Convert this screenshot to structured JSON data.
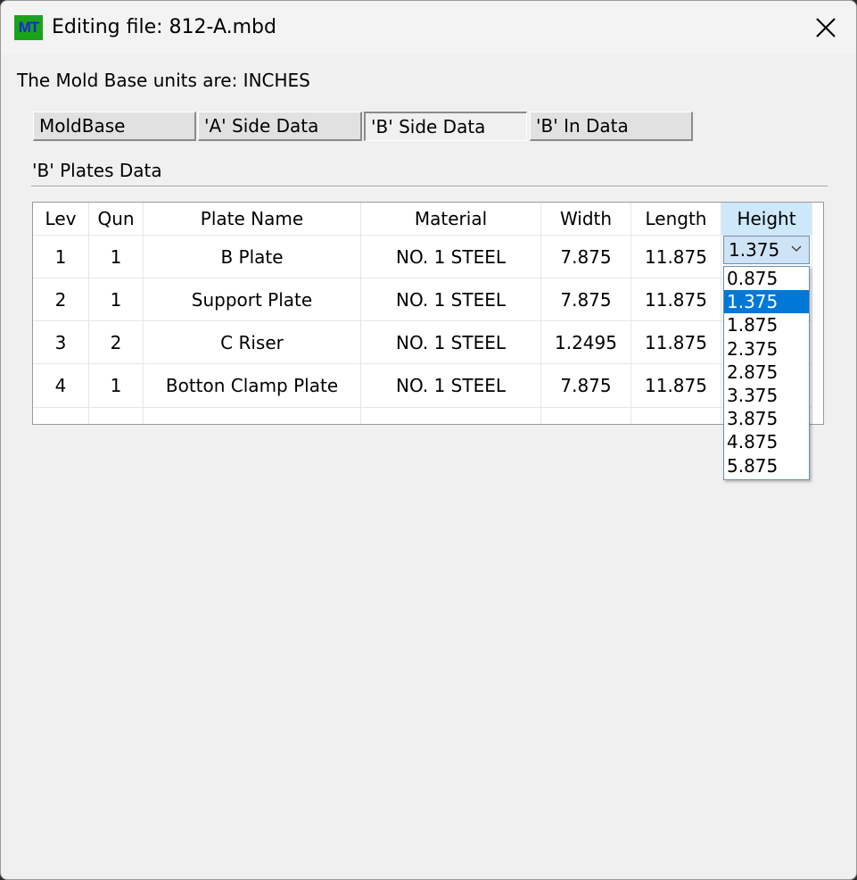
{
  "window": {
    "app_icon_text": "MT",
    "title": "Editing file: 812-A.mbd"
  },
  "units_label": "The Mold Base units are: INCHES",
  "tabs": [
    {
      "label": "MoldBase",
      "active": false
    },
    {
      "label": "'A' Side Data",
      "active": false
    },
    {
      "label": "'B' Side Data",
      "active": true
    },
    {
      "label": "'B' In Data",
      "active": false
    }
  ],
  "section_label": "'B' Plates Data",
  "table": {
    "headers": [
      "Lev",
      "Qun",
      "Plate Name",
      "Material",
      "Width",
      "Length",
      "Height"
    ],
    "rows": [
      [
        "1",
        "1",
        "B Plate",
        "NO. 1 STEEL",
        "7.875",
        "11.875",
        ""
      ],
      [
        "2",
        "1",
        "Support Plate",
        "NO. 1 STEEL",
        "7.875",
        "11.875",
        ""
      ],
      [
        "3",
        "2",
        "C Riser",
        "NO. 1 STEEL",
        "1.2495",
        "11.875",
        ""
      ],
      [
        "4",
        "1",
        "Botton Clamp Plate",
        "NO. 1 STEEL",
        "7.875",
        "11.875",
        ""
      ]
    ]
  },
  "height_dropdown": {
    "value": "1.375",
    "options": [
      "0.875",
      "1.375",
      "1.875",
      "2.375",
      "2.875",
      "3.375",
      "3.875",
      "4.875",
      "5.875"
    ],
    "selected_index": 1
  },
  "colors": {
    "selection": "#0078d7",
    "header_selected": "#cde8fa",
    "icon_bg": "#1aa31a",
    "icon_text": "#1a2ad0"
  }
}
